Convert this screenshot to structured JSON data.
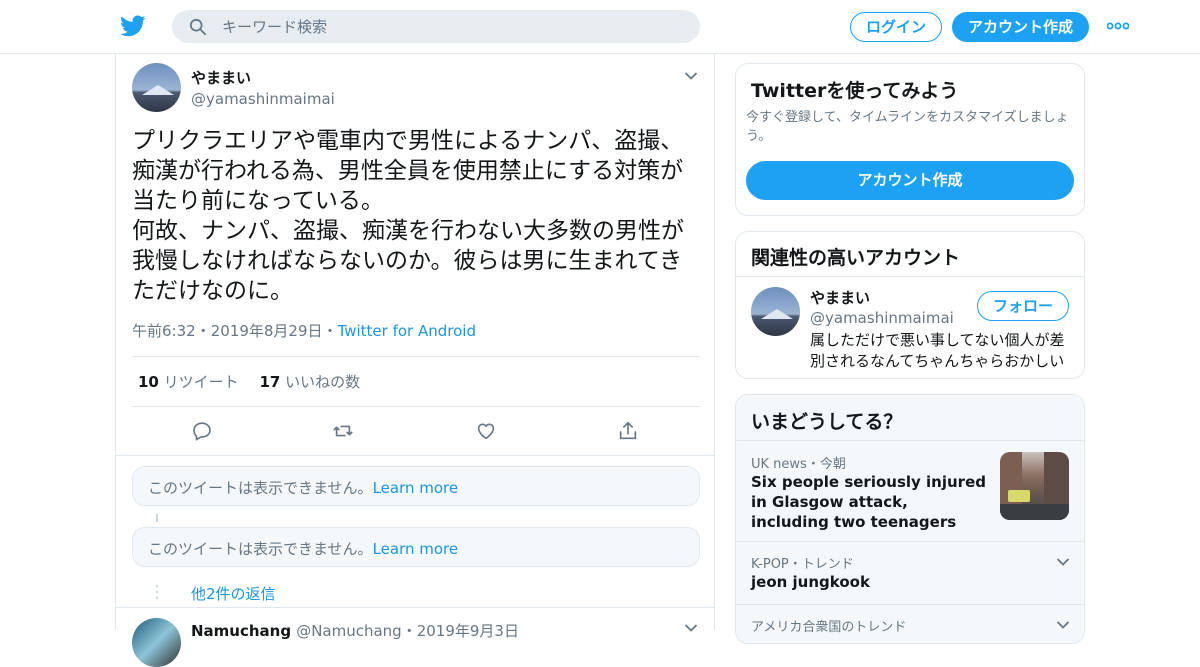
{
  "header": {
    "search_placeholder": "キーワード検索",
    "login_label": "ログイン",
    "signup_label": "アカウント作成"
  },
  "tweet": {
    "name": "やままい",
    "handle": "@yamashinmaimai",
    "text": "プリクラエリアや電車内で男性によるナンパ、盗撮、痴漢が行われる為、男性全員を使用禁止にする対策が当たり前になっている。\n何故、ナンパ、盗撮、痴漢を行わない大多数の男性が我慢しなければならないのか。彼らは男に生まれてきただけなのに。",
    "time": "午前6:32",
    "date": "2019年8月29日",
    "source": "Twitter for Android",
    "retweet_count": "10",
    "retweet_label": "リツイート",
    "like_count": "17",
    "like_label": "いいねの数",
    "sep": "・"
  },
  "replies": {
    "unavailable_text": "このツイートは表示できません。",
    "learn_more": "Learn more",
    "more_replies": "他2件の返信",
    "next_name": "Namuchang",
    "next_handle": "@Namuchang",
    "next_date": "2019年9月3日"
  },
  "signup_card": {
    "title": "Twitterを使ってみよう",
    "desc": "今すぐ登録して、タイムラインをカスタマイズしましょう。",
    "button": "アカウント作成"
  },
  "related": {
    "title": "関連性の高いアカウント",
    "name": "やままい",
    "handle": "@yamashinmaimai",
    "follow": "フォロー",
    "bio": "属しただけで悪い事してない個人が差別されるなんてちゃんちゃらおかしい"
  },
  "trends": {
    "title": "いまどうしてる？",
    "items": [
      {
        "meta": "UK news",
        "time": "今朝",
        "name": "Six people seriously injured in Glasgow attack, including two teenagers"
      },
      {
        "meta": "K-POP・トレンド",
        "name": "jeon jungkook"
      },
      {
        "meta": "アメリカ合衆国のトレンド"
      }
    ]
  },
  "colors": {
    "accent": "#1da1f2",
    "link": "#1b95e0",
    "muted": "#657786",
    "border": "#e1e8ed"
  }
}
